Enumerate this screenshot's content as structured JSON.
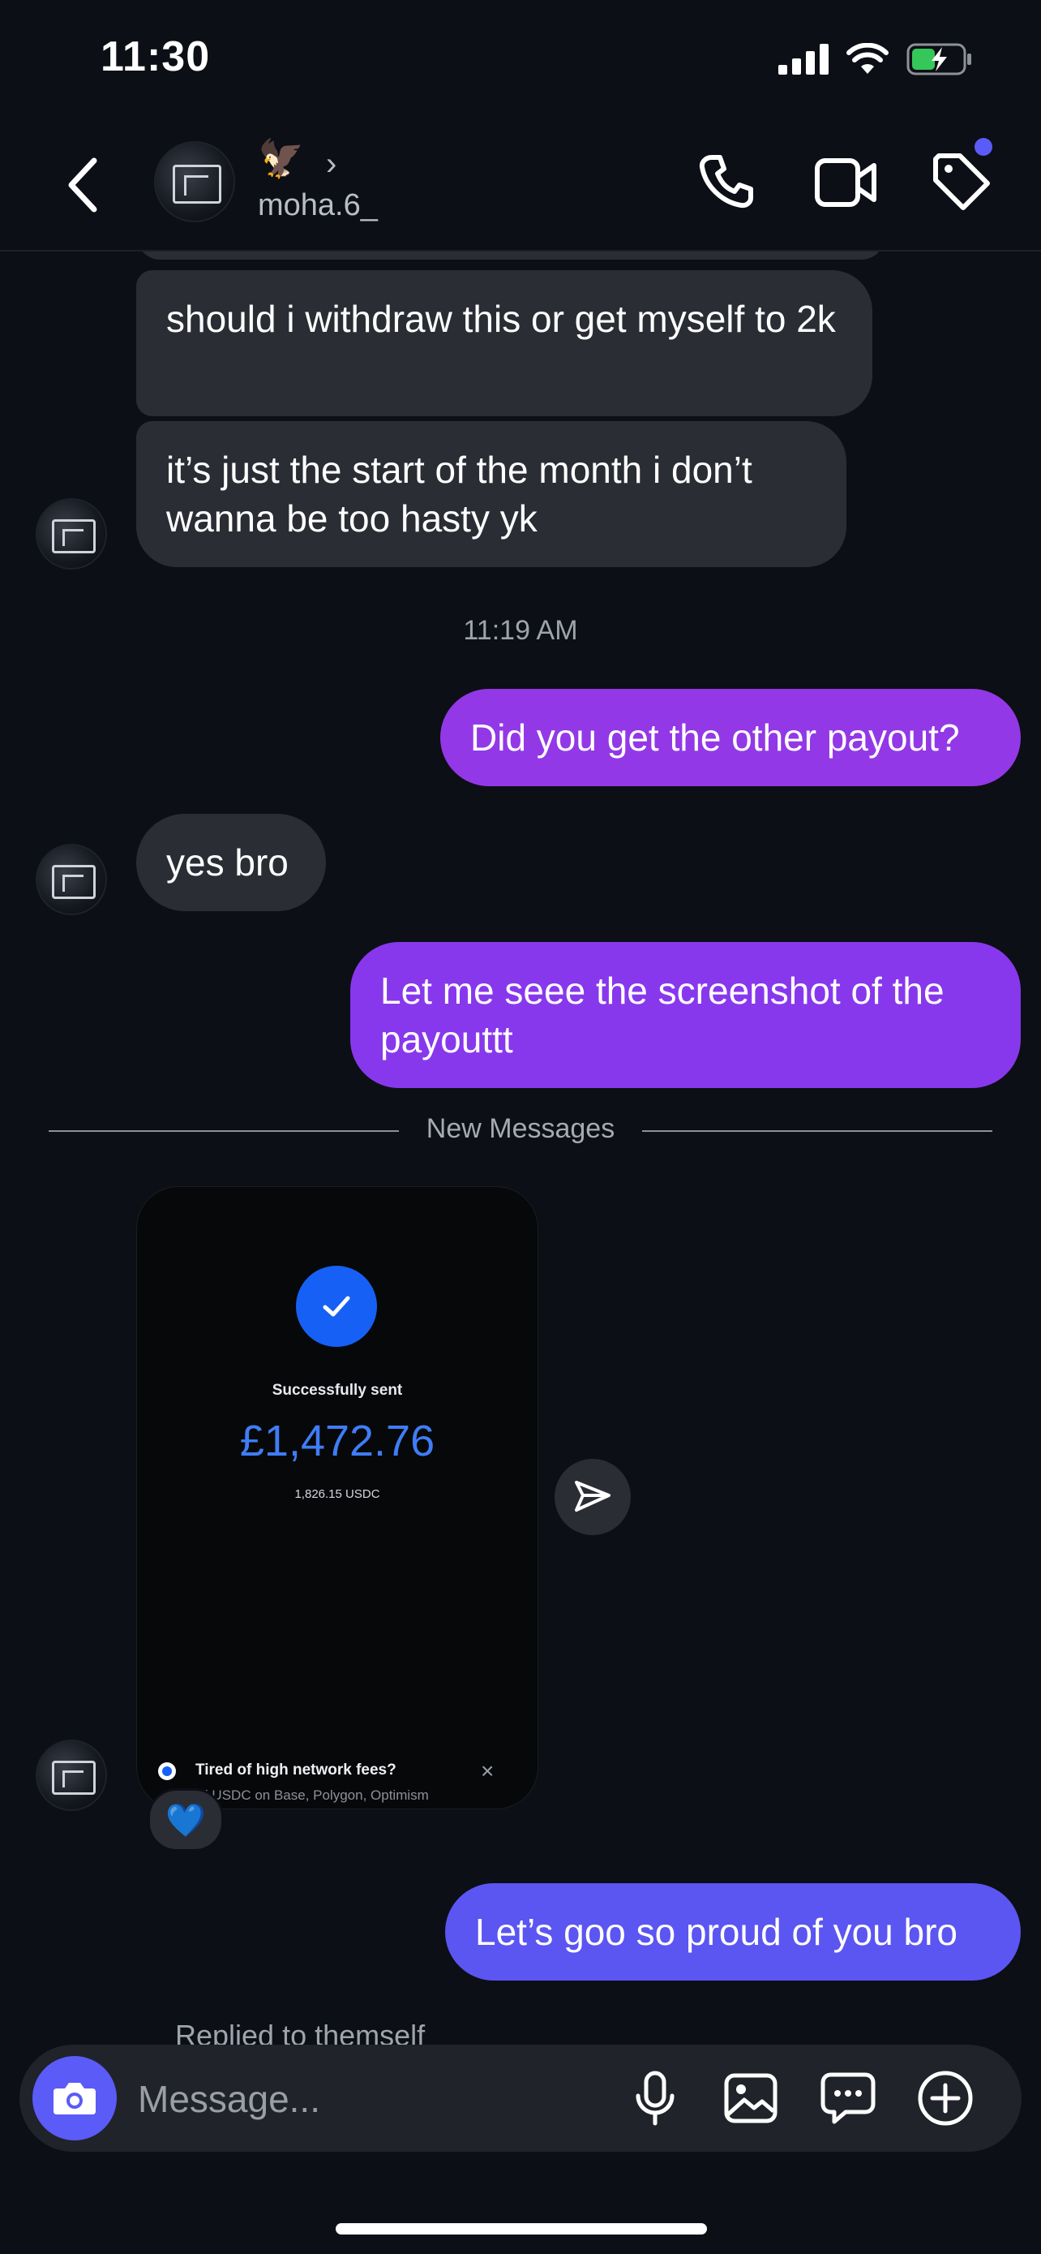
{
  "status_bar": {
    "time": "11:30"
  },
  "header": {
    "username": "moha.6_",
    "emoji": "🦅",
    "chevron": "›"
  },
  "messages": {
    "in_1": "should i withdraw this or get myself to 2k",
    "in_2": "it’s just the start of the month i don’t wanna be too hasty yk",
    "timestamp": "11:19 AM",
    "out_1": "Did you get the other payout?",
    "in_3": "yes bro",
    "out_2": "Let me seee the screenshot of the payouttt",
    "new_messages": "New Messages",
    "out_3": "Let’s goo so proud of you bro",
    "replied": "Replied to themself"
  },
  "shared_screenshot": {
    "status": "Successfully sent",
    "amount": "£1,472.76",
    "crypto_amount": "1,826.15 USDC",
    "promo_title": "Tired of high network fees?",
    "promo_sub": "Send USDC on Base, Polygon, Optimism",
    "promo_close": "×"
  },
  "reaction": {
    "emoji": "💙"
  },
  "composer": {
    "placeholder": "Message..."
  },
  "colors": {
    "background": "#0c0f15",
    "incoming": "#2a2d34",
    "outgoing": "#8a3be8",
    "accent": "#5b5bf7",
    "success_blue": "#1760f5"
  }
}
